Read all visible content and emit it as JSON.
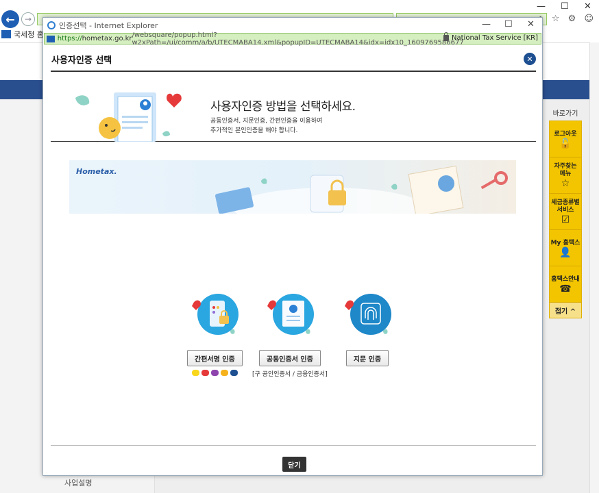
{
  "background": {
    "tab_title": "국세청 홈택",
    "window_controls": [
      "—",
      "☐",
      "✕"
    ],
    "toolbar_icons": "⌂ ☆ ⚙ ☺",
    "left_menu_item": "사업설명"
  },
  "quick_menu": {
    "title": "바로가기",
    "items": [
      {
        "label": "로그아웃",
        "icon": "🔓"
      },
      {
        "label": "자주찾는\n메뉴",
        "icon": "☆"
      },
      {
        "label": "세금종류별\n서비스",
        "icon": "☑"
      },
      {
        "label": "My 홈택스",
        "icon": "👤"
      },
      {
        "label": "홈택스안내",
        "icon": "☎"
      }
    ],
    "fold_label": "접기 ^"
  },
  "popup_window": {
    "title": "인증선택 - Internet Explorer",
    "url_scheme": "https://",
    "url_host": "hometax.go.kr",
    "url_path": "/websquare/popup.html?w2xPath=/ui/comm/a/b/UTECMABA14.xml&popupID=UTECMABA14&idx=idx10_1609769586677",
    "security_label": "National Tax Service [KR]",
    "controls": [
      "—",
      "☐",
      "✕"
    ]
  },
  "dialog": {
    "title": "사용자인증 선택",
    "headline": "사용자인증 방법을 선택하세요.",
    "description_line1": "공동인증서, 지문인증, 간편인증을 이용하여",
    "description_line2": "추가적인 본인인증을 해야 합니다.",
    "banner_logo": "Hometax.",
    "methods": [
      {
        "label": "간편서명 인증",
        "sub": ""
      },
      {
        "label": "공동인증서 인증",
        "sub": "[구 공인인증서 / 금융인증서]"
      },
      {
        "label": "지문 인증",
        "sub": ""
      }
    ],
    "close_label": "닫기"
  },
  "colors": {
    "accent": "#1d4f91",
    "navbar": "#2a4f8f",
    "quick_menu": "#f2c500",
    "address_bar": "#d6efc0"
  }
}
